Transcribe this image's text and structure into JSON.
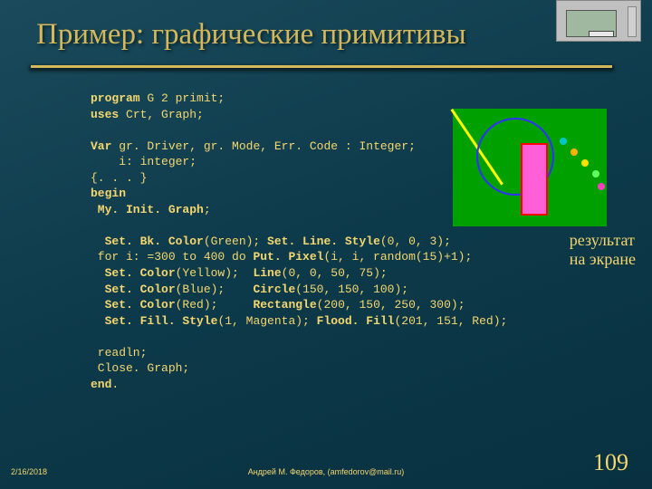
{
  "title": "Пример: графические примитивы",
  "result_label_l1": "результат",
  "result_label_l2": "на экране",
  "footer": {
    "date": "2/16/2018",
    "author": "Андрей М. Федоров, (amfedorov@mail.ru)"
  },
  "slide_number": "109",
  "code": {
    "l1a": "program",
    "l1b": " G 2 primit;",
    "l2a": "uses ",
    "l2b": "Crt, Graph;",
    "l3a": "Var ",
    "l3b": "gr. Driver, gr. Mode, Err. Code : Integer;",
    "l4": "    i: integer;",
    "l5": "{. . . }",
    "l6": "begin",
    "l7": " My. Init. Graph",
    "l7b": ";",
    "l8a": "  Set. Bk. Color",
    "l8b": "(Green); ",
    "l8c": "Set. Line. Style",
    "l8d": "(0, 0, 3);",
    "l9a": " for i: =300 to 400 do ",
    "l9b": "Put. Pixel",
    "l9c": "(i, i, random(15)+1);",
    "l10a": "  Set. Color",
    "l10b": "(Yellow);  ",
    "l10c": "Line",
    "l10d": "(0, 0, 50, 75);",
    "l11a": "  Set. Color",
    "l11b": "(Blue);    ",
    "l11c": "Circle",
    "l11d": "(150, 150, 100);",
    "l12a": "  Set. Color",
    "l12b": "(Red);     ",
    "l12c": "Rectangle",
    "l12d": "(200, 150, 250, 300);",
    "l13a": "  Set. Fill. Style",
    "l13b": "(1, Magenta); ",
    "l13c": "Flood. Fill",
    "l13d": "(201, 151, Red);",
    "l14": " readln;",
    "l15": " Close. Graph;",
    "l16a": "end",
    "l16b": "."
  }
}
